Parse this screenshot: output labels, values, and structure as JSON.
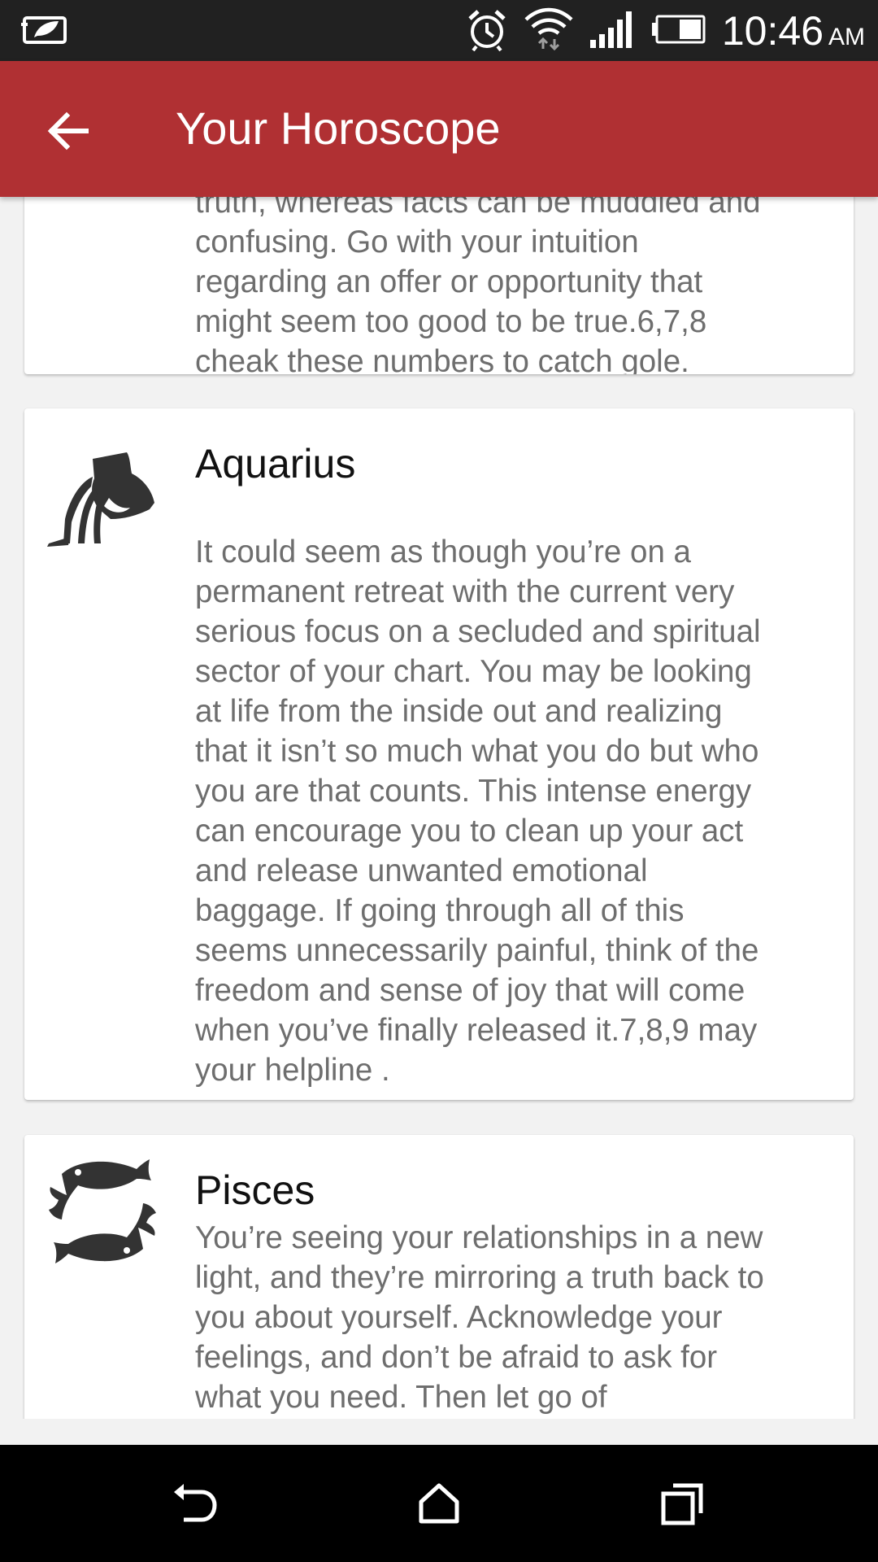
{
  "status_bar": {
    "time": "10:46",
    "ampm": "AM",
    "icons": [
      "notification-app-icon",
      "alarm-icon",
      "wifi-icon",
      "signal-icon",
      "battery-icon"
    ]
  },
  "app_bar": {
    "title": "Your Horoscope",
    "back_icon": "arrow-back-icon",
    "color": "#b03033"
  },
  "cards": [
    {
      "sign": "",
      "text": "truth, whereas facts can be muddled and\nconfusing. Go with your intuition\nregarding an offer or opportunity that\nmight seem too good to be true.6,7,8\ncheak these numbers to catch gole."
    },
    {
      "sign": "Aquarius",
      "icon": "aquarius-icon",
      "text": " It could seem as though you’re on a\npermanent retreat with the current very\nserious focus on a secluded and spiritual\nsector of your chart. You may be looking\nat life from the inside out and realizing\nthat it isn’t so much what you do but who\nyou are that counts. This intense energy\ncan encourage you to clean up your act\nand release unwanted emotional\nbaggage. If going through all of this\nseems unnecessarily painful, think of the\nfreedom and sense of joy that will come\nwhen you’ve finally released it.7,8,9 may\nyour helpline ."
    },
    {
      "sign": "Pisces",
      "icon": "pisces-icon",
      "text": "You’re seeing your relationships in a new\nlight, and they’re mirroring a truth back to\nyou about yourself. Acknowledge your\nfeelings, and don’t be afraid to ask for\nwhat you need. Then let go of"
    }
  ],
  "nav_bar": {
    "buttons": [
      "back-nav-icon",
      "home-nav-icon",
      "recents-nav-icon"
    ]
  }
}
